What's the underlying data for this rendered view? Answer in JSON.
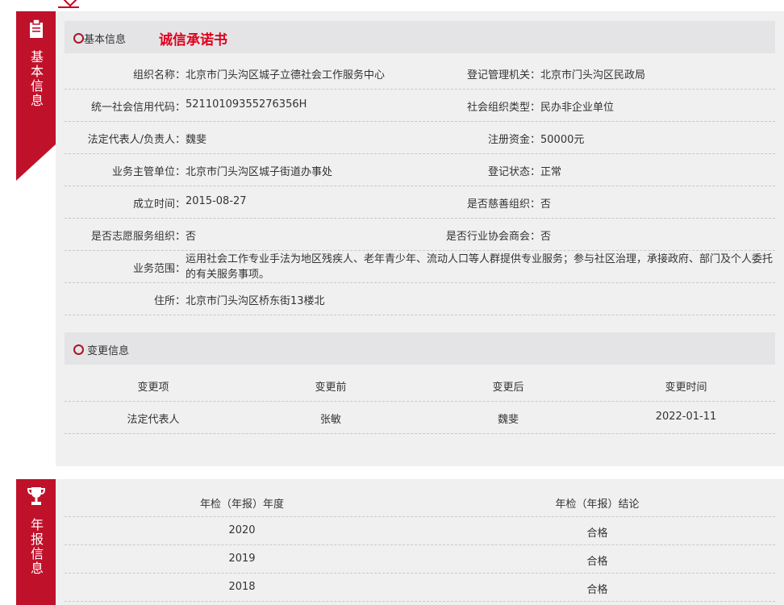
{
  "sections": {
    "basic": {
      "tab_icon": "clipboard-icon",
      "tab_title": "基本信息"
    },
    "annual": {
      "tab_icon": "trophy-icon",
      "tab_title": "年报信息"
    }
  },
  "basic_info": {
    "header": "基本信息",
    "promise_link": "诚信承诺书",
    "rows": [
      {
        "k1": "组织名称：",
        "v1": "北京市门头沟区城子立德社会工作服务中心",
        "k2": "登记管理机关：",
        "v2": "北京市门头沟区民政局"
      },
      {
        "k1": "统一社会信用代码：",
        "v1": "52110109355276356H",
        "k2": "社会组织类型：",
        "v2": "民办非企业单位"
      },
      {
        "k1": "法定代表人/负责人：",
        "v1": "魏斐",
        "k2": "注册资金：",
        "v2": "50000元"
      },
      {
        "k1": "业务主管单位：",
        "v1": "北京市门头沟区城子街道办事处",
        "k2": "登记状态：",
        "v2": "正常"
      },
      {
        "k1": "成立时间：",
        "v1": "2015-08-27",
        "k2": "是否慈善组织：",
        "v2": "否"
      },
      {
        "k1": "是否志愿服务组织：",
        "v1": "否",
        "k2": "是否行业协会商会：",
        "v2": "否"
      }
    ],
    "scope_label": "业务范围：",
    "scope_value": "运用社会工作专业手法为地区残疾人、老年青少年、流动人口等人群提供专业服务；参与社区治理，承接政府、部门及个人委托的有关服务事项。",
    "address_label": "住所：",
    "address_value": "北京市门头沟区桥东街13楼北"
  },
  "change_info": {
    "header": "变更信息",
    "columns": [
      "变更项",
      "变更前",
      "变更后",
      "变更时间"
    ],
    "rows": [
      [
        "法定代表人",
        "张敏",
        "魏斐",
        "2022-01-11"
      ]
    ]
  },
  "annual_report": {
    "columns": [
      "年检（年报）年度",
      "年检（年报）结论"
    ],
    "rows": [
      [
        "2020",
        "合格"
      ],
      [
        "2019",
        "合格"
      ],
      [
        "2018",
        "合格"
      ]
    ]
  },
  "colors": {
    "accent": "#c0112b",
    "promise": "#e0001b",
    "panel": "#f0f0f0"
  }
}
